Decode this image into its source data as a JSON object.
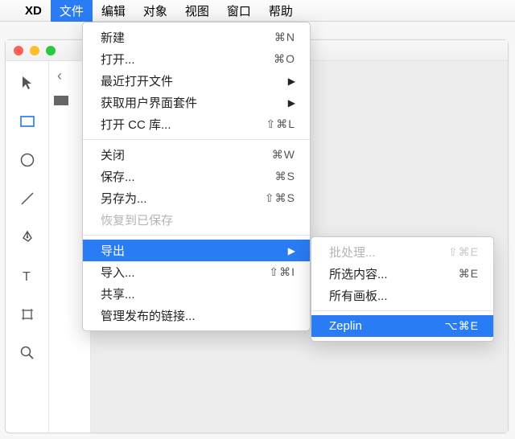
{
  "menubar": {
    "app": "XD",
    "items": [
      "文件",
      "编辑",
      "对象",
      "视图",
      "窗口",
      "帮助"
    ],
    "active_index": 0
  },
  "menu_file": {
    "groups": [
      [
        {
          "label": "新建",
          "shortcut": "⌘N",
          "arrow": false,
          "disabled": false,
          "hl": false
        },
        {
          "label": "打开...",
          "shortcut": "⌘O",
          "arrow": false,
          "disabled": false,
          "hl": false
        },
        {
          "label": "最近打开文件",
          "shortcut": "",
          "arrow": true,
          "disabled": false,
          "hl": false
        },
        {
          "label": "获取用户界面套件",
          "shortcut": "",
          "arrow": true,
          "disabled": false,
          "hl": false
        },
        {
          "label": "打开 CC 库...",
          "shortcut": "⇧⌘L",
          "arrow": false,
          "disabled": false,
          "hl": false
        }
      ],
      [
        {
          "label": "关闭",
          "shortcut": "⌘W",
          "arrow": false,
          "disabled": false,
          "hl": false
        },
        {
          "label": "保存...",
          "shortcut": "⌘S",
          "arrow": false,
          "disabled": false,
          "hl": false
        },
        {
          "label": "另存为...",
          "shortcut": "⇧⌘S",
          "arrow": false,
          "disabled": false,
          "hl": false
        },
        {
          "label": "恢复到已保存",
          "shortcut": "",
          "arrow": false,
          "disabled": true,
          "hl": false
        }
      ],
      [
        {
          "label": "导出",
          "shortcut": "",
          "arrow": true,
          "disabled": false,
          "hl": true
        },
        {
          "label": "导入...",
          "shortcut": "⇧⌘I",
          "arrow": false,
          "disabled": false,
          "hl": false
        },
        {
          "label": "共享...",
          "shortcut": "",
          "arrow": false,
          "disabled": false,
          "hl": false
        },
        {
          "label": "管理发布的链接...",
          "shortcut": "",
          "arrow": false,
          "disabled": false,
          "hl": false
        }
      ]
    ]
  },
  "menu_export": {
    "groups": [
      [
        {
          "label": "批处理...",
          "shortcut": "⇧⌘E",
          "arrow": false,
          "disabled": true,
          "hl": false
        },
        {
          "label": "所选内容...",
          "shortcut": "⌘E",
          "arrow": false,
          "disabled": false,
          "hl": false
        },
        {
          "label": "所有画板...",
          "shortcut": "",
          "arrow": false,
          "disabled": false,
          "hl": false
        }
      ],
      [
        {
          "label": "Zeplin",
          "shortcut": "⌥⌘E",
          "arrow": false,
          "disabled": false,
          "hl": true
        }
      ]
    ]
  },
  "tools": [
    "select",
    "rectangle",
    "ellipse",
    "line",
    "pen",
    "text",
    "artboard",
    "zoom"
  ],
  "colors": {
    "accent": "#2a7cf4"
  }
}
